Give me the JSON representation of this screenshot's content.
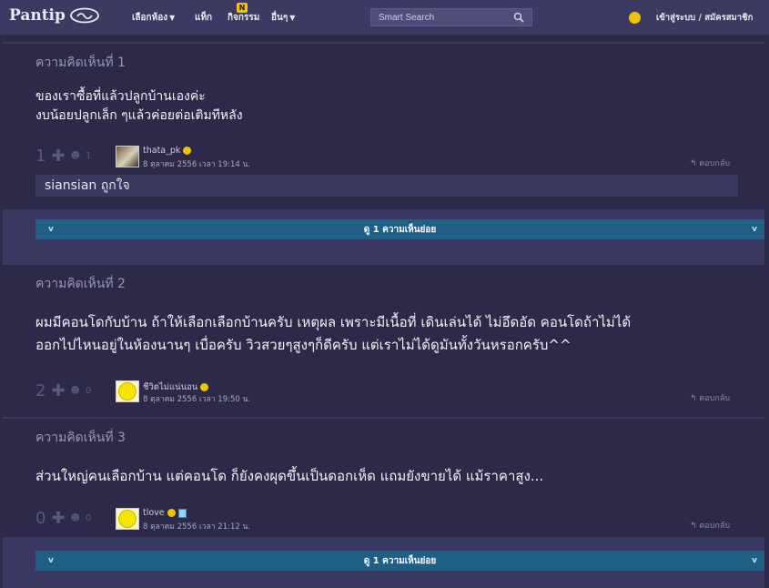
{
  "nav": {
    "logo": "Pantip",
    "menu_rooms": "เลือกห้อง",
    "menu_tags": "แท็ก",
    "menu_activity": "กิจกรรม",
    "activity_badge": "N",
    "menu_more": "อื่นๆ",
    "search_placeholder": "Smart Search",
    "login": "เข้าสู่ระบบ / สมัครสมาชิก"
  },
  "comments": [
    {
      "label": "ความคิดเห็นที่ 1",
      "lines": [
        "ของเราซื้อที่แล้วปลูกบ้านเองค่ะ",
        "งบน้อยปลูกเล็ก ๆแล้วค่อยต่อเติมทีหลัง"
      ],
      "votes": "1",
      "emotions": "1",
      "user": "thata_pk",
      "date": "8 ตุลาคม 2556 เวลา 19:14 น.",
      "reply": "ตอบกลับ",
      "reaction_text": "siansian ถูกใจ"
    },
    {
      "label": "ความคิดเห็นที่ 2",
      "lines": [
        "ผมมีคอนโดกับบ้าน ถ้าให้เลือกเลือกบ้านครับ เหตุผล เพราะมีเนื้อที่ เดินเล่นได้ ไม่อึดอัด คอนโดถ้าไม่ได้",
        "ออกไปไหนอยู่ในห้องนานๆ เบื่อครับ วิวสวยๆสูงๆก็ดีครับ แต่เราไม่ได้ดูมันทั้งวันหรอกครับ^^"
      ],
      "votes": "2",
      "emotions": "0",
      "user": "ชีวิตไม่แน่นอน",
      "date": "8 ตุลาคม 2556 เวลา 19:50 น.",
      "reply": "ตอบกลับ"
    },
    {
      "label": "ความคิดเห็นที่ 3",
      "lines": [
        "ส่วนใหญ่คนเลือกบ้าน แต่คอนโด ก็ยังคงผุดขึ้นเป็นดอกเห็ด แถมยังขายได้ แม้ราคาสูง..."
      ],
      "votes": "0",
      "emotions": "0",
      "user": "tlove",
      "date": "8 ตุลาคม 2556 เวลา 21:12 น.",
      "reply": "ตอบกลับ"
    }
  ],
  "subcomments_toggle": "ดู 1 ความเห็นย่อย",
  "colors": {
    "background": "#2d2a49",
    "nav": "#3c3963",
    "toggle": "#1f5f86",
    "badge": "#f3c300"
  }
}
